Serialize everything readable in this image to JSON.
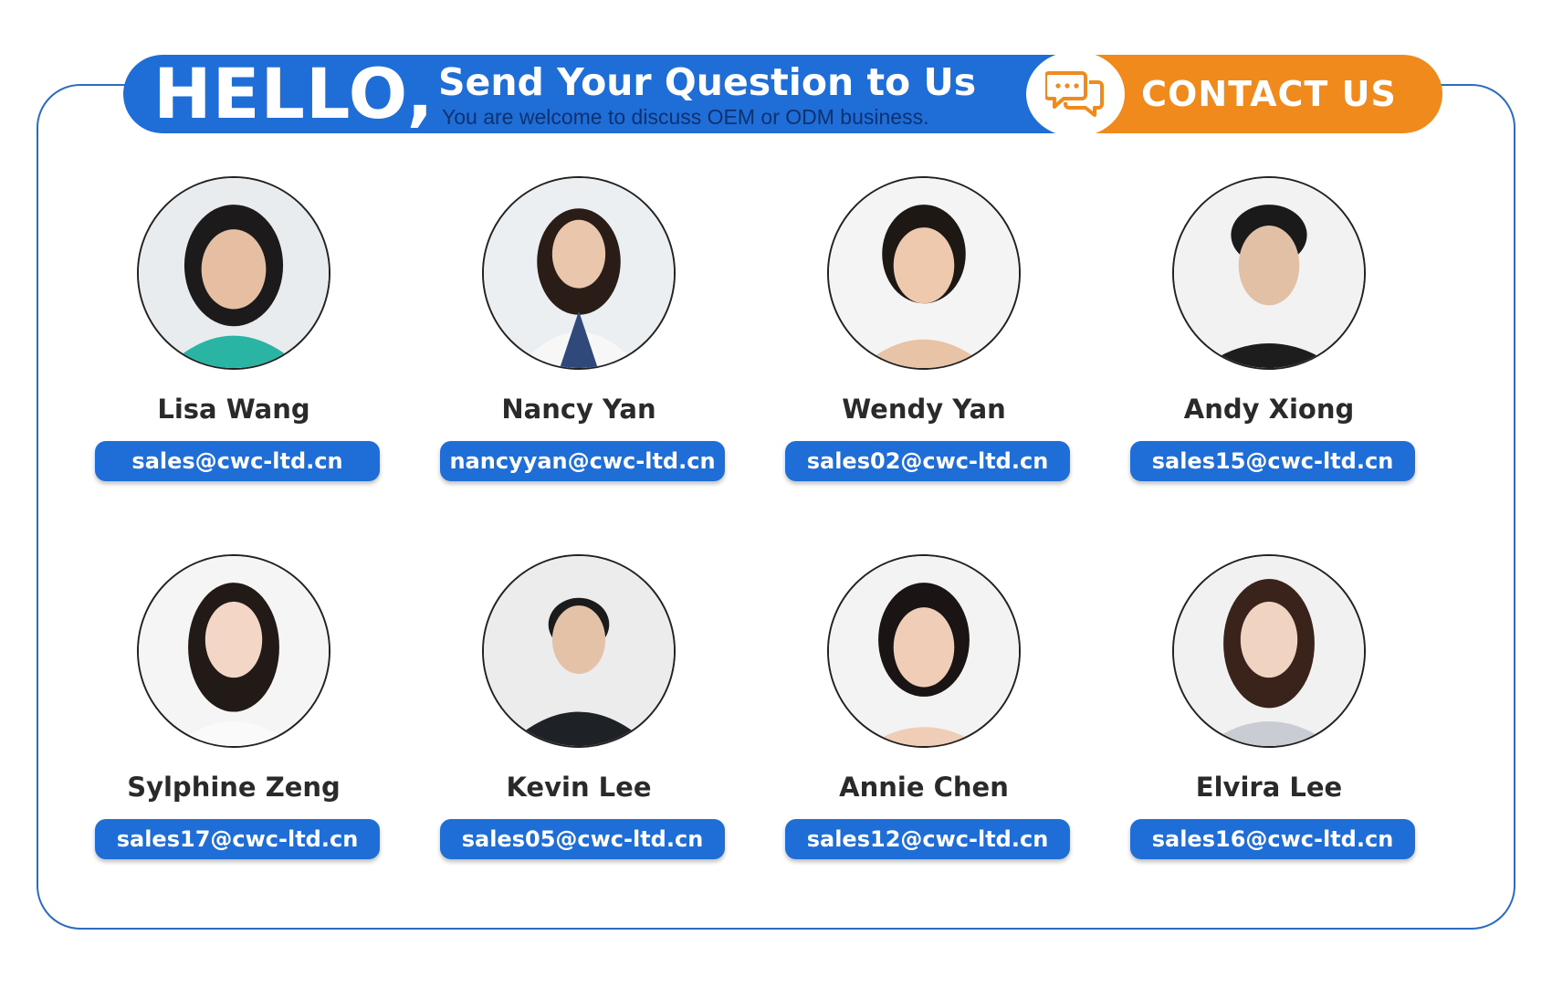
{
  "colors": {
    "brand_blue": "#1f6dd6",
    "accent_orange": "#f08a1c",
    "frame_border": "#2d6bc0"
  },
  "header": {
    "hello": "HELLO,",
    "headline": "Send Your Question to Us",
    "subline": "You are welcome to discuss OEM or ODM business.",
    "chat_icon": "chat-bubbles-icon",
    "contact_label": "CONTACT US"
  },
  "team": [
    {
      "name": "Lisa Wang",
      "email": "sales@cwc-ltd.cn",
      "photo": "avatar-photo"
    },
    {
      "name": "Nancy Yan",
      "email": "nancyyan@cwc-ltd.cn",
      "photo": "avatar-photo"
    },
    {
      "name": "Wendy Yan",
      "email": "sales02@cwc-ltd.cn",
      "photo": "avatar-photo"
    },
    {
      "name": "Andy Xiong",
      "email": "sales15@cwc-ltd.cn",
      "photo": "avatar-photo"
    },
    {
      "name": "Sylphine Zeng",
      "email": "sales17@cwc-ltd.cn",
      "photo": "avatar-photo"
    },
    {
      "name": "Kevin Lee",
      "email": "sales05@cwc-ltd.cn",
      "photo": "avatar-photo"
    },
    {
      "name": "Annie Chen",
      "email": "sales12@cwc-ltd.cn",
      "photo": "avatar-photo"
    },
    {
      "name": "Elvira Lee",
      "email": "sales16@cwc-ltd.cn",
      "photo": "avatar-photo"
    }
  ]
}
